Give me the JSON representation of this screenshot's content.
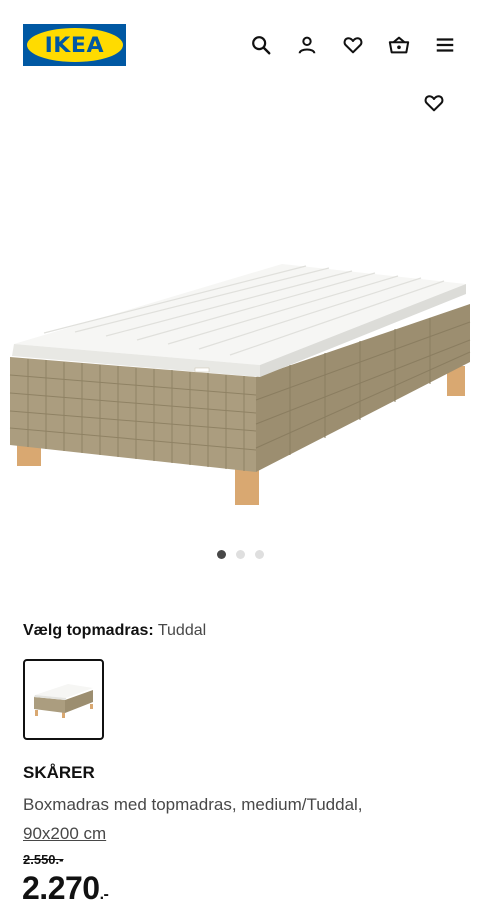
{
  "header": {
    "logo_text": "IKEA",
    "icons": [
      "search-icon",
      "profile-icon",
      "heart-icon",
      "basket-icon",
      "menu-icon"
    ]
  },
  "gallery": {
    "favorite_icon": "heart-icon",
    "dots_count": 3,
    "active_dot": 0
  },
  "variant": {
    "label": "Vælg topmadras:",
    "value": "Tuddal"
  },
  "product": {
    "name": "SKÅRER",
    "description": "Boxmadras med topmadras, medium/Tuddal,",
    "size": "90x200 cm",
    "old_price": "2.550.-",
    "price": "2.270",
    "price_suffix": ".-"
  },
  "colors": {
    "ikea_blue": "#0058a3",
    "ikea_yellow": "#ffdb00",
    "text": "#111111",
    "muted_text": "#484848",
    "base_fabric": "#a89a7c",
    "legs": "#d9a871"
  }
}
